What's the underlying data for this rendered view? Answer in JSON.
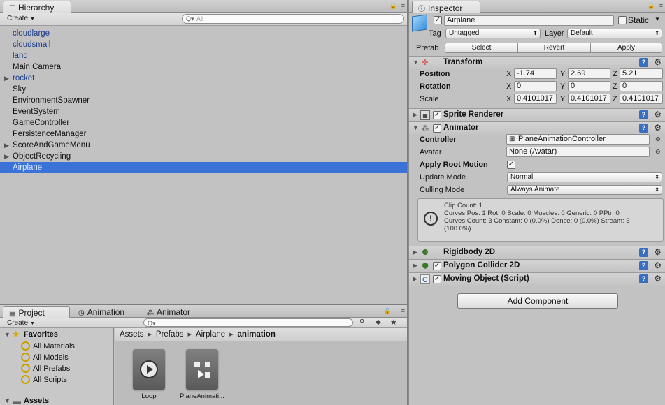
{
  "hierarchy": {
    "tab_label": "Hierarchy",
    "create_label": "Create",
    "search_placeholder": "All",
    "items": [
      {
        "label": "cloudlarge"
      },
      {
        "label": "cloudsmall"
      },
      {
        "label": "land"
      },
      {
        "label": "Main Camera"
      },
      {
        "label": "rocket"
      },
      {
        "label": "Sky"
      },
      {
        "label": "EnvironmentSpawner"
      },
      {
        "label": "EventSystem"
      },
      {
        "label": "GameController"
      },
      {
        "label": "PersistenceManager"
      },
      {
        "label": "ScoreAndGameMenu"
      },
      {
        "label": "ObjectRecycling"
      },
      {
        "label": "Airplane"
      }
    ]
  },
  "project": {
    "tabs": {
      "project": "Project",
      "animation": "Animation",
      "animator": "Animator"
    },
    "create_label": "Create",
    "favorites_label": "Favorites",
    "favorites": [
      "All Materials",
      "All Models",
      "All Prefabs",
      "All Scripts"
    ],
    "assets_label": "Assets",
    "breadcrumbs": [
      "Assets",
      "Prefabs",
      "Airplane",
      "animation"
    ],
    "assets": [
      {
        "label": "Loop"
      },
      {
        "label": "PlaneAnimati..."
      }
    ]
  },
  "inspector": {
    "tab_label": "Inspector",
    "object_name": "Airplane",
    "static_label": "Static",
    "tag_label": "Tag",
    "tag_value": "Untagged",
    "layer_label": "Layer",
    "layer_value": "Default",
    "prefab_label": "Prefab",
    "prefab_select": "Select",
    "prefab_revert": "Revert",
    "prefab_apply": "Apply",
    "transform": {
      "title": "Transform",
      "position_label": "Position",
      "rotation_label": "Rotation",
      "scale_label": "Scale",
      "x": "X",
      "y": "Y",
      "z": "Z",
      "position": [
        "-1.74",
        "2.69",
        "5.21"
      ],
      "rotation": [
        "0",
        "0",
        "0"
      ],
      "scale": [
        "0.4101017",
        "0.4101017",
        "0.4101017"
      ]
    },
    "sprite_renderer": {
      "title": "Sprite Renderer"
    },
    "animator": {
      "title": "Animator",
      "controller_label": "Controller",
      "controller_value": "PlaneAnimationController",
      "avatar_label": "Avatar",
      "avatar_value": "None (Avatar)",
      "apply_root_motion_label": "Apply Root Motion",
      "update_mode_label": "Update Mode",
      "update_mode_value": "Normal",
      "culling_mode_label": "Culling Mode",
      "culling_mode_value": "Always Animate",
      "info": "Clip Count: 1\nCurves Pos: 1 Rot: 0 Scale: 0 Muscles: 0 Generic: 0 PPtr: 0\nCurves Count: 3 Constant: 0 (0.0%) Dense: 0 (0.0%) Stream: 3\n(100.0%)"
    },
    "rigidbody": {
      "title": "Rigidbody 2D"
    },
    "polygon_collider": {
      "title": "Polygon Collider 2D"
    },
    "moving_object": {
      "title": "Moving Object (Script)"
    },
    "add_component_label": "Add Component"
  }
}
